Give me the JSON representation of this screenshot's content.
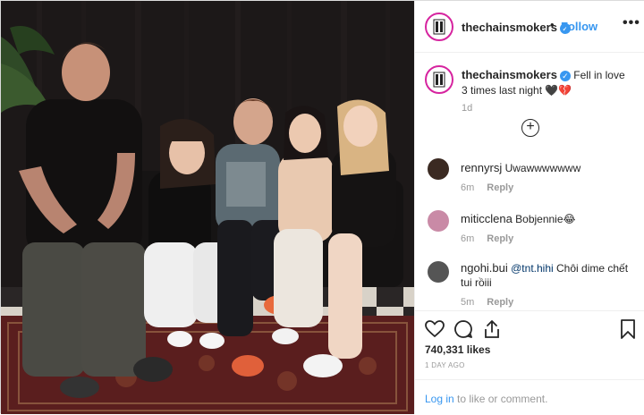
{
  "post": {
    "username": "thechainsmokers",
    "verified_glyph": "✓",
    "dot": "•",
    "follow_label": "Follow",
    "more_icon": "more-options-icon",
    "caption": {
      "username": "thechainsmokers",
      "text": "Fell in love 3 times last night",
      "emojis": "🖤💔",
      "time": "1d"
    },
    "load_more_glyph": "+",
    "comments": [
      {
        "username": "rennyrsj",
        "text": "Uwawwwwwww",
        "time": "6m",
        "reply": "Reply",
        "avatar_color": "#3b2a22"
      },
      {
        "username": "miticclena",
        "text": "Bobjennie",
        "emoji": "😂",
        "time": "6m",
        "reply": "Reply",
        "avatar_color": "#c98aa6"
      },
      {
        "username": "ngohi.bui",
        "mention": "@tnt.hihi",
        "text": "Chôi dime chết tui rồiii",
        "time": "5m",
        "reply": "Reply",
        "avatar_color": "#555555"
      }
    ],
    "likes": "740,331 likes",
    "date": "1 DAY AGO",
    "login_link": "Log in",
    "login_rest": " to like or comment."
  },
  "colors": {
    "link_blue": "#3897f0",
    "muted": "#999999",
    "text": "#262626",
    "story_ring": "#d6249f"
  }
}
